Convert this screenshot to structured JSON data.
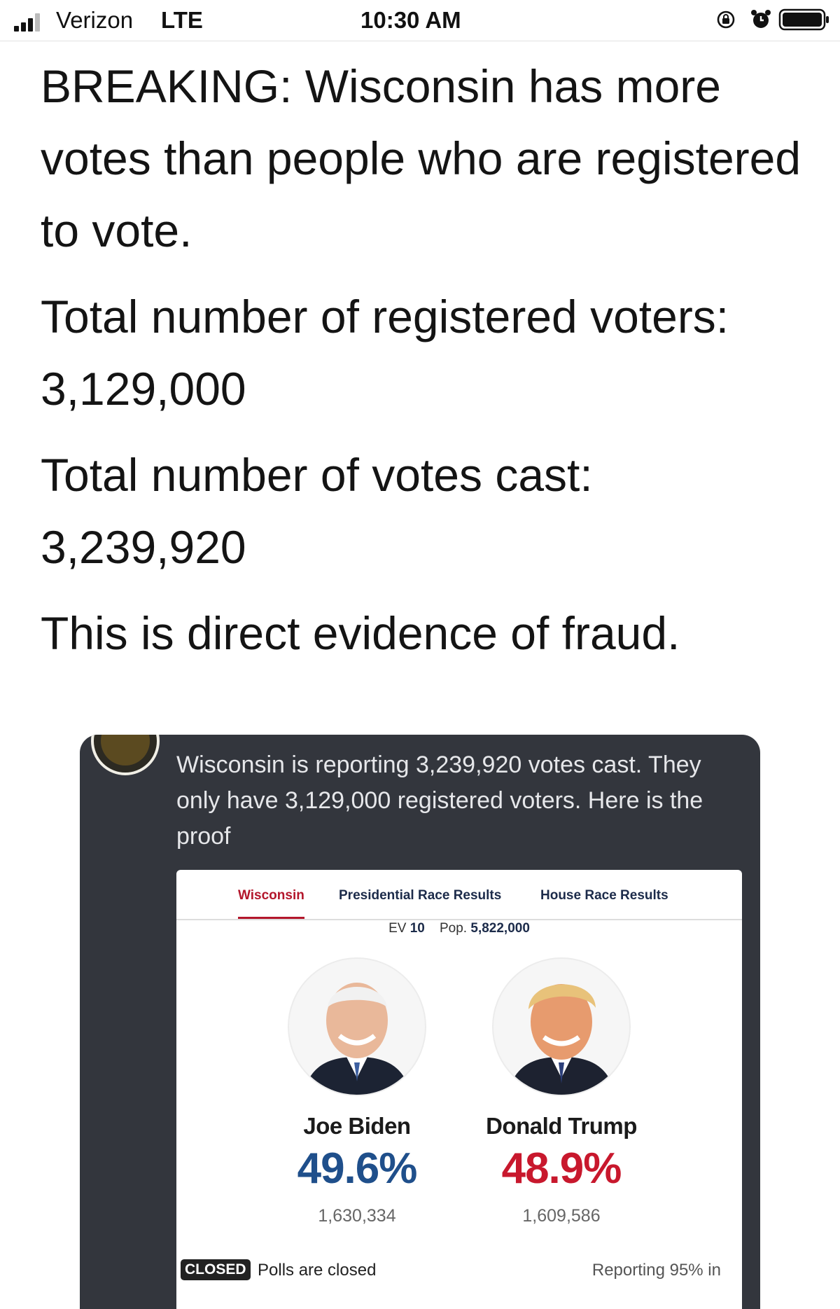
{
  "status_bar": {
    "carrier": "Verizon",
    "network": "LTE",
    "time": "10:30 AM",
    "icons": [
      "signal-icon",
      "orientation-lock-icon",
      "alarm-icon",
      "battery-icon"
    ]
  },
  "tweet": {
    "line1": "BREAKING: Wisconsin has more votes than people who are registered to vote.",
    "registered_label": "Total number of registered voters:",
    "registered_value": "3,129,000",
    "cast_label": "Total number of votes cast:",
    "cast_value": "3,239,920",
    "conclusion": "This is direct evidence of fraud."
  },
  "embedded_post": {
    "text": "Wisconsin is reporting 3,239,920 votes cast. They only have 3,129,000 registered voters. Here is the proof",
    "results": {
      "tabs": [
        {
          "label": "Wisconsin",
          "active": true
        },
        {
          "label": "Presidential Race Results",
          "active": false
        },
        {
          "label": "House Race Results",
          "active": false
        }
      ],
      "ev_label": "EV",
      "ev_value": "10",
      "pop_label": "Pop.",
      "pop_value": "5,822,000",
      "candidates": [
        {
          "name": "Joe Biden",
          "pct": "49.6%",
          "votes": "1,630,334",
          "color": "#1f4f8b"
        },
        {
          "name": "Donald Trump",
          "pct": "48.9%",
          "votes": "1,609,586",
          "color": "#c8182d"
        }
      ],
      "status_badge": "CLOSED",
      "status_text": "Polls are closed",
      "reporting": "Reporting 95% in"
    }
  }
}
